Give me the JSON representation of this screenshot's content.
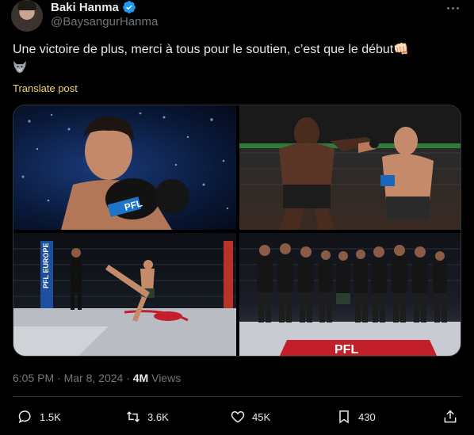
{
  "author": {
    "name": "Baki Hanma",
    "handle": "@BaysangurHanma",
    "verified": true,
    "verified_color": "#1d9bf0"
  },
  "tweet": {
    "text": "Une victoire de plus, merci à tous pour le soutien, c’est que le début👊🏻",
    "emoji_icon": "wolf-emoji",
    "translate_label": "Translate post"
  },
  "media": {
    "images": [
      {
        "icon": "fighter-portrait-photo",
        "text": "PFL"
      },
      {
        "icon": "fight-exchange-photo",
        "text": ""
      },
      {
        "icon": "cage-kick-photo",
        "text": "PFL EUROPE"
      },
      {
        "icon": "team-photo",
        "text": "PFL"
      }
    ]
  },
  "meta": {
    "time": "6:05 PM",
    "date": "Mar 8, 2024",
    "separator": "·",
    "views_count": "4M",
    "views_label": "Views"
  },
  "actions": {
    "replies": "1.5K",
    "reposts": "3.6K",
    "likes": "45K",
    "bookmarks": "430"
  },
  "colors": {
    "background": "#000000",
    "text": "#e7e9ea",
    "muted": "#71767b",
    "translate": "#f5d565",
    "border": "#2f3336"
  }
}
